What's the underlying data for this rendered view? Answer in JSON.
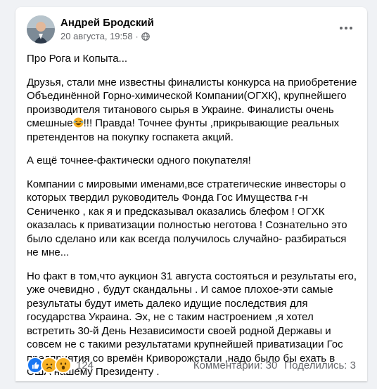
{
  "post": {
    "author": "Андрей Бродский",
    "timestamp": "20 августа, 19:58",
    "separator": "·",
    "privacy_icon": "globe-icon",
    "more_icon": "more-horizontal-icon",
    "paragraphs": {
      "p1": "Про Рога и Копыта...",
      "p2a": "Друзья, стали мне известны финалисты конкурса на приобретение Объединённой Горно-химической Компании(ОГХК), крупнейшего производителя титанового сырья в Украине. Финалисты очень смешные",
      "p2b": "!!! Правда! Точнее фунты ,прикрывающие реальных претендентов на покупку госпакета акций.",
      "p3": "А ещё точнее-фактически одного покупателя!",
      "p4": "Компании с мировыми именами,все стратегические инвесторы о которых твердил руководитель Фонда Гос Имущества г-н Сениченко , как я и предсказывал оказались блефом ! ОГХК оказалась  к приватизации полностью неготова ! Сознательно это было сделано или как всегда получилось случайно- разбираться не мне...",
      "p5": "Но факт в том,что аукцион 31 августа состояться и результаты его, уже очевидно , будут скандальны . И самое плохое-эти самые результаты будут иметь далеко идущие последствия для государства Украина. Эх, не с таким настроением ,я хотел встретить 30-й День Независимости своей родной Державы и совсем не с такими результатами крупнейшей приватизации Гос предприятия со времён Криворожстали ,надо было бы ехать в США нашему Президенту ."
    },
    "inline_emoji": "laughing-emoji"
  },
  "footer": {
    "reaction_icons": [
      "like-icon",
      "sad-icon",
      "wow-icon"
    ],
    "reaction_count": "124",
    "comments": "Комментарии: 30",
    "shares": "Поделились: 3"
  },
  "colors": {
    "background": "#f0f2f5",
    "card": "#ffffff",
    "secondary_text": "#65676b",
    "like_blue": "#1877f2",
    "emoji_yellow": "#f7b125"
  }
}
